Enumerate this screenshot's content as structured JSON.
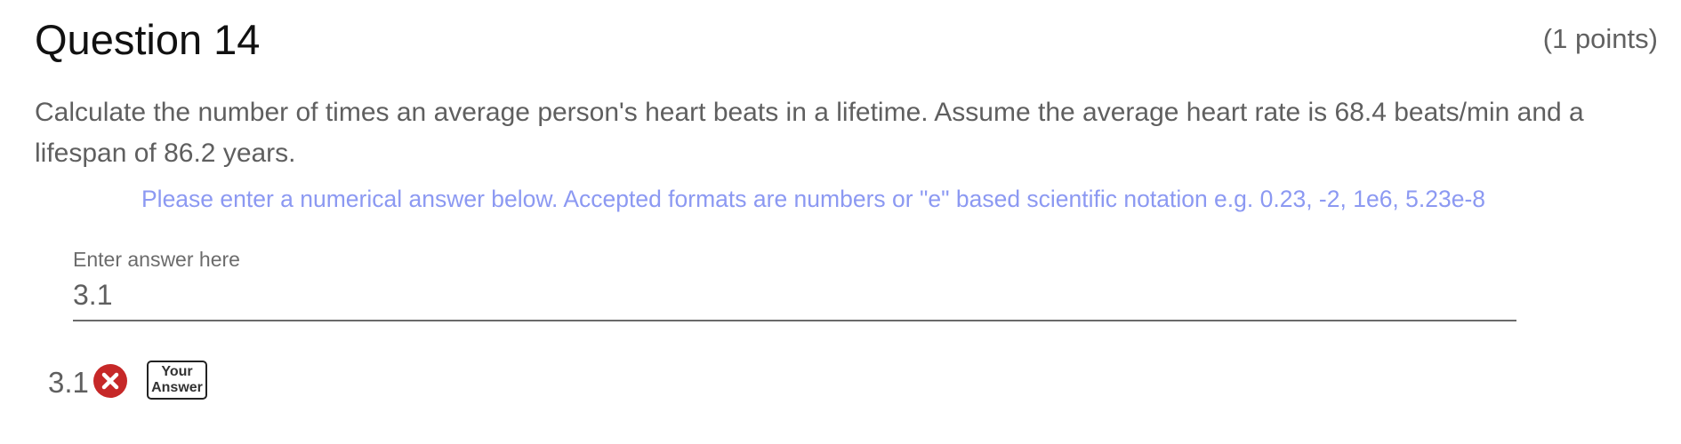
{
  "question": {
    "title": "Question 14",
    "points": "(1 points)",
    "text_line1": "Calculate the number of times an average person's heart beats in a lifetime. Assume the average heart rate is 68.4 beats/min and a",
    "text_line2": "lifespan of 86.2 years."
  },
  "instructions": "Please enter a numerical answer below. Accepted formats are numbers or \"e\" based scientific notation e.g. 0.23, -2, 1e6, 5.23e-8",
  "answer_field": {
    "label": "Enter answer here",
    "value": "3.1"
  },
  "submitted": {
    "value": "3.1",
    "status_icon": "wrong-x-icon",
    "badge_line1": "Your",
    "badge_line2": "Answer"
  },
  "colors": {
    "instructions": "#8c99f2",
    "wrong_icon": "#c62828"
  }
}
